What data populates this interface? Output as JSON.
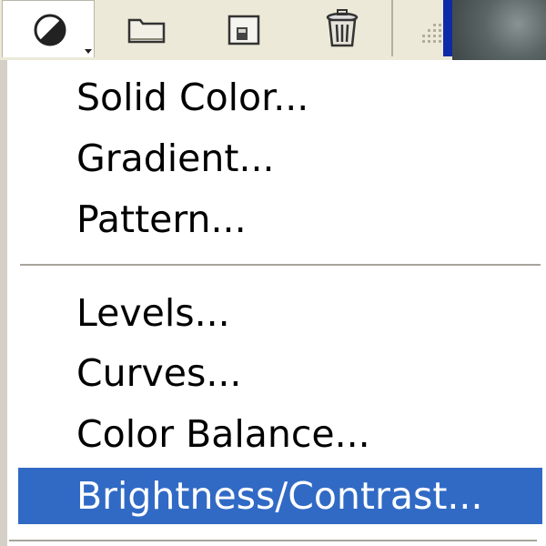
{
  "toolbar": {
    "buttons": [
      {
        "name": "adjustment-layer-button",
        "icon": "half-circle-icon",
        "pressed": true
      },
      {
        "name": "new-group-button",
        "icon": "folder-icon",
        "pressed": false
      },
      {
        "name": "new-layer-button",
        "icon": "new-layer-icon",
        "pressed": false
      },
      {
        "name": "delete-layer-button",
        "icon": "trash-icon",
        "pressed": false
      }
    ]
  },
  "menu": {
    "groups": [
      {
        "items": [
          {
            "label": "Solid Color..."
          },
          {
            "label": "Gradient..."
          },
          {
            "label": "Pattern..."
          }
        ]
      },
      {
        "items": [
          {
            "label": "Levels..."
          },
          {
            "label": "Curves..."
          },
          {
            "label": "Color Balance..."
          },
          {
            "label": "Brightness/Contrast...",
            "highlighted": true
          }
        ]
      }
    ]
  },
  "colors": {
    "menu_highlight": "#316ac5",
    "toolbar_bg": "#ece9d8",
    "menu_text": "#000000",
    "highlight_text": "#ffffff"
  }
}
